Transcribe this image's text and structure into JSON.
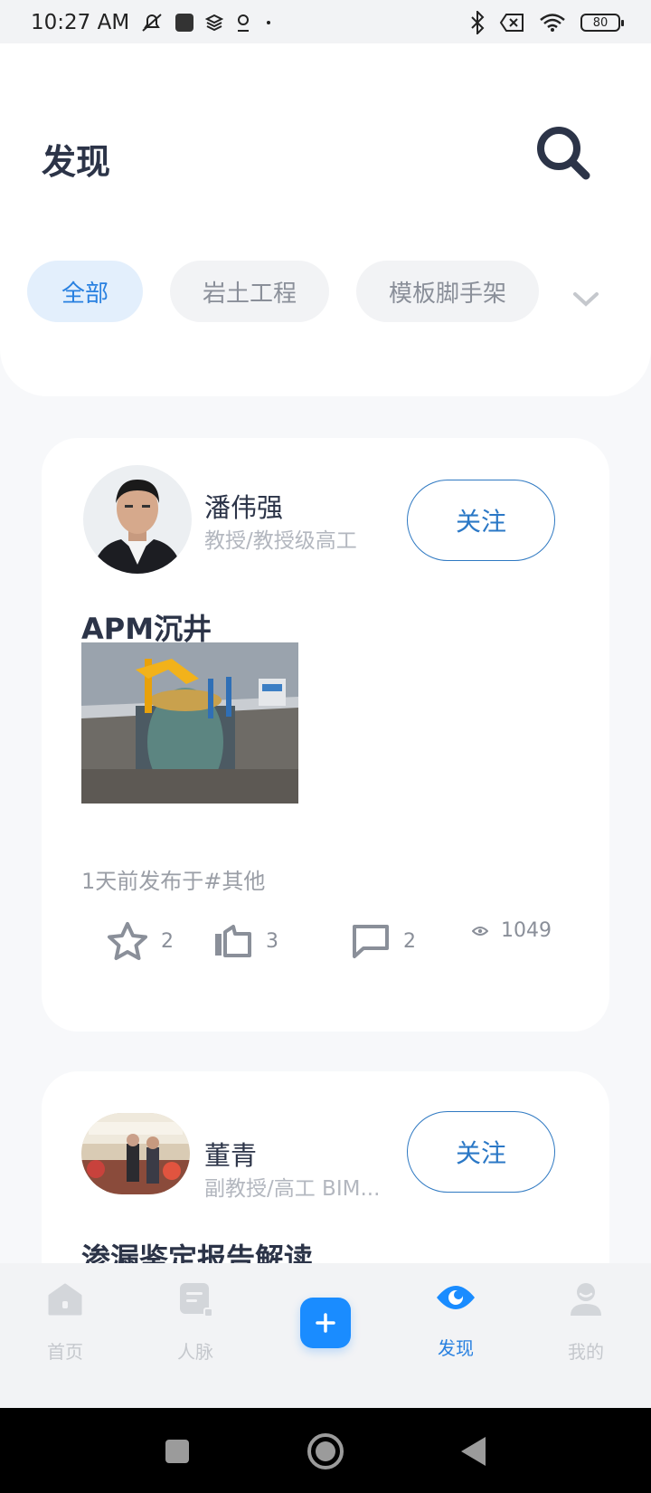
{
  "status_bar": {
    "time": "10:27 AM",
    "battery": "80",
    "icons": [
      "mute-icon",
      "notification-square-icon",
      "stack-icon",
      "location-icon",
      "dot-icon",
      "bluetooth-icon",
      "sim-off-icon",
      "wifi-icon",
      "battery-icon"
    ]
  },
  "header": {
    "title": "发现",
    "search_icon": "search-icon",
    "tabs": [
      {
        "label": "全部",
        "active": true
      },
      {
        "label": "岩土工程",
        "active": false
      },
      {
        "label": "模板脚手架",
        "active": false
      }
    ],
    "expand_icon": "chevron-down-icon"
  },
  "feed": [
    {
      "author_name": "潘伟强",
      "author_title": "教授/教授级高工",
      "follow_label": "关注",
      "post_title": "APM沉井",
      "meta": "1天前发布于#其他",
      "stats": {
        "favorites": "2",
        "likes": "3",
        "comments": "2",
        "views": "1049"
      }
    },
    {
      "author_name": "董青",
      "author_title": "副教授/高工  BIM...",
      "follow_label": "关注",
      "post_title": "渗漏鉴定报告解读"
    }
  ],
  "bottom_nav": {
    "items": [
      {
        "label": "首页",
        "icon": "home-icon"
      },
      {
        "label": "人脉",
        "icon": "contacts-icon"
      },
      {
        "label": "",
        "icon": "plus-icon"
      },
      {
        "label": "发现",
        "icon": "eye-icon",
        "active": true
      },
      {
        "label": "我的",
        "icon": "profile-icon"
      }
    ]
  },
  "colors": {
    "accent": "#2880e0",
    "add_button": "#1a8cff",
    "title_text": "#2c3448",
    "muted_text": "#9a9ea6"
  }
}
